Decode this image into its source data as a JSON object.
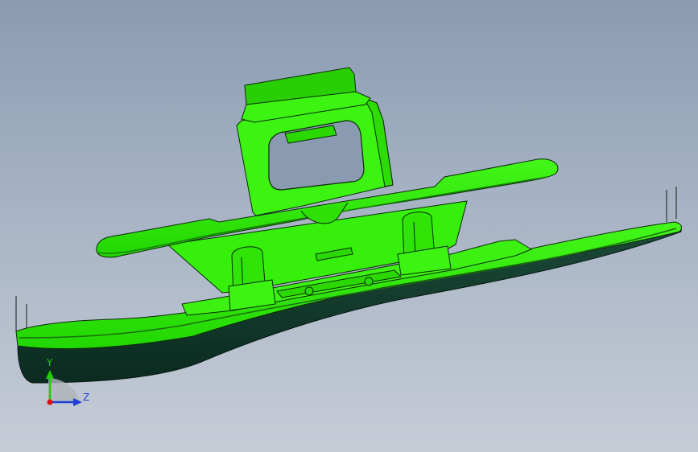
{
  "viewport": {
    "background_top": "#8a9bb1",
    "background_bottom": "#c6ccd6"
  },
  "model": {
    "color": "#33ee00",
    "shadow_color": "#0f3326",
    "edge_color": "#0a2a06"
  },
  "triad": {
    "x_label": "",
    "y_label": "Y",
    "z_label": "Z",
    "y_color": "#22cc00",
    "z_color": "#1f3fd8",
    "origin_color": "#e01010"
  }
}
